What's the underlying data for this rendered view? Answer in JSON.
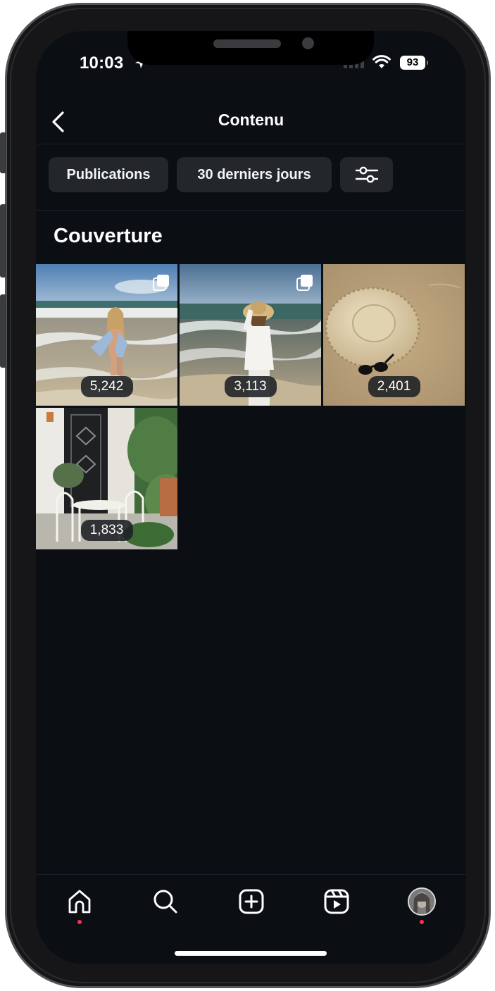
{
  "status_bar": {
    "time": "10:03",
    "battery": "93"
  },
  "header": {
    "title": "Contenu"
  },
  "filters": [
    {
      "label": "Publications"
    },
    {
      "label": "30 derniers jours"
    }
  ],
  "section": {
    "title": "Couverture"
  },
  "posts": [
    {
      "count": "5,242",
      "type": "carousel"
    },
    {
      "count": "3,113",
      "type": "carousel"
    },
    {
      "count": "2,401",
      "type": "photo"
    },
    {
      "count": "1,833",
      "type": "photo"
    }
  ],
  "colors": {
    "background": "#0b0f13",
    "chip": "#23272c",
    "notification_dot": "#ff3040"
  },
  "icons": [
    "back-icon",
    "filter-sliders-icon",
    "carousel-icon",
    "home-icon",
    "search-icon",
    "create-icon",
    "reels-icon",
    "profile-avatar"
  ]
}
